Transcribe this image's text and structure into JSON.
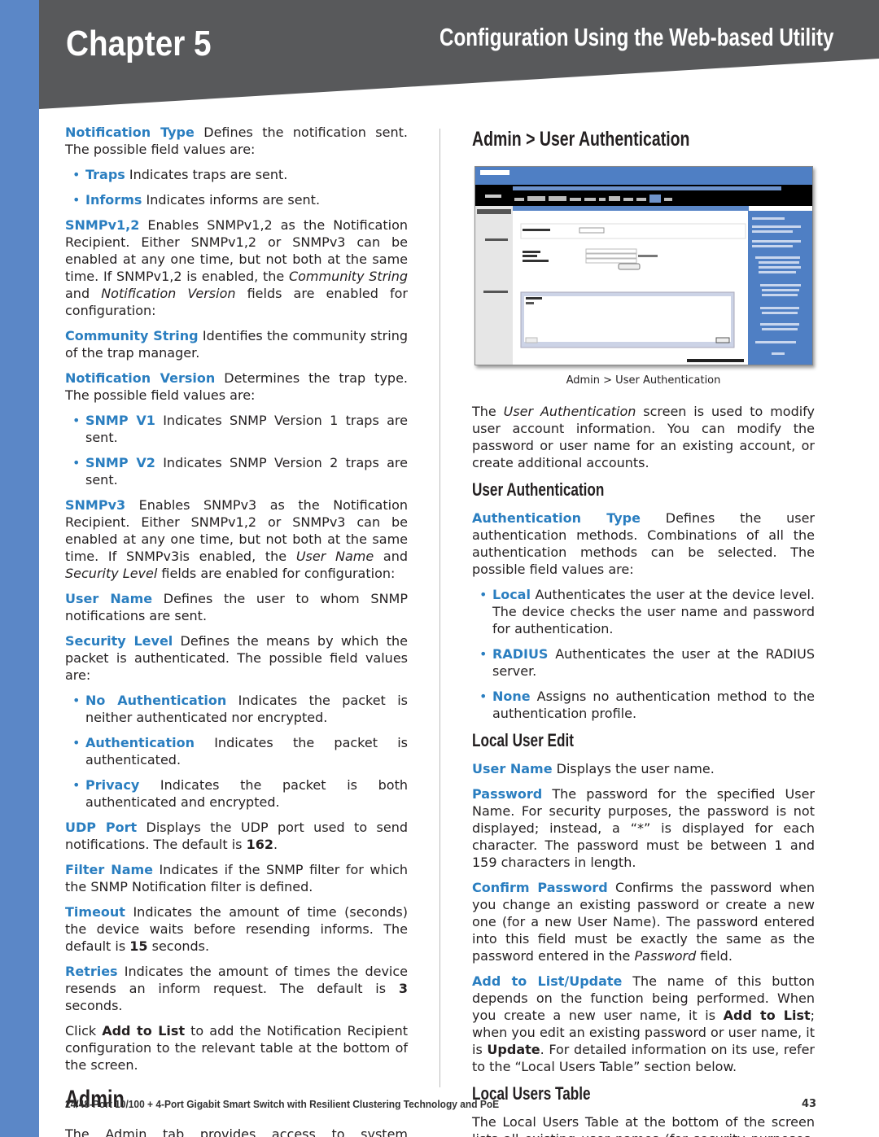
{
  "header": {
    "chapter": "Chapter 5",
    "title": "Configuration Using the Web-based Utility"
  },
  "colors": {
    "sidebar": "#5b87c7",
    "header": "#58595b",
    "term": "#2a7ec0"
  },
  "left": [
    {
      "type": "p",
      "runs": [
        [
          "Notification Type",
          "t"
        ],
        [
          " Defines the notification sent. The possible field values are:",
          ""
        ]
      ]
    },
    {
      "type": "li",
      "runs": [
        [
          "Traps",
          "t"
        ],
        [
          "  Indicates traps are sent.",
          ""
        ]
      ]
    },
    {
      "type": "li",
      "runs": [
        [
          "Informs",
          "t"
        ],
        [
          "  Indicates informs are sent.",
          ""
        ]
      ]
    },
    {
      "type": "p",
      "runs": [
        [
          "SNMPv1,2",
          "t"
        ],
        [
          " Enables SNMPv1,2 as the Notification Recipient. Either SNMPv1,2 or SNMPv3 can be enabled at any one time, but not both at the same time. If SNMPv1,2 is enabled, the ",
          ""
        ],
        [
          "Community String",
          "i"
        ],
        [
          " and ",
          ""
        ],
        [
          "Notification Version",
          "i"
        ],
        [
          " fields are enabled for configuration:",
          ""
        ]
      ]
    },
    {
      "type": "p",
      "runs": [
        [
          "Community String",
          "t"
        ],
        [
          "  Identifies the community string of the trap manager.",
          ""
        ]
      ]
    },
    {
      "type": "p",
      "runs": [
        [
          "Notification Version",
          "t"
        ],
        [
          "  Determines the trap type. The possible field values are:",
          ""
        ]
      ]
    },
    {
      "type": "li",
      "runs": [
        [
          "SNMP V1",
          "t"
        ],
        [
          "  Indicates SNMP Version 1 traps are sent.",
          ""
        ]
      ]
    },
    {
      "type": "li",
      "runs": [
        [
          "SNMP V2",
          "t"
        ],
        [
          "  Indicates SNMP Version 2 traps are sent.",
          ""
        ]
      ]
    },
    {
      "type": "p",
      "runs": [
        [
          "SNMPv3",
          "t"
        ],
        [
          "  Enables SNMPv3 as the Notification Recipient. Either SNMPv1,2 or SNMPv3 can be enabled at any one time, but not both at the same time. If SNMPv3is enabled, the ",
          ""
        ],
        [
          "User Name",
          "i"
        ],
        [
          " and ",
          ""
        ],
        [
          "Security Level",
          "i"
        ],
        [
          " fields are enabled for configuration:",
          ""
        ]
      ]
    },
    {
      "type": "p",
      "runs": [
        [
          "User Name",
          "t"
        ],
        [
          "  Defines the user to whom SNMP notifications are sent.",
          ""
        ]
      ]
    },
    {
      "type": "p",
      "runs": [
        [
          "Security Level",
          "t"
        ],
        [
          "  Defines the means by which the packet is authenticated. The possible field values are:",
          ""
        ]
      ]
    },
    {
      "type": "li",
      "runs": [
        [
          "No Authentication",
          "t"
        ],
        [
          "  Indicates the packet is neither authenticated nor encrypted.",
          ""
        ]
      ]
    },
    {
      "type": "li",
      "runs": [
        [
          "Authentication",
          "t"
        ],
        [
          "  Indicates the packet is authenticated.",
          ""
        ]
      ]
    },
    {
      "type": "li",
      "runs": [
        [
          "Privacy",
          "t"
        ],
        [
          "  Indicates the packet is both authenticated and encrypted.",
          ""
        ]
      ]
    },
    {
      "type": "p",
      "runs": [
        [
          "UDP Port",
          "t"
        ],
        [
          "  Displays the UDP port used to send notifications. The default is ",
          ""
        ],
        [
          "162",
          "b"
        ],
        [
          ".",
          ""
        ]
      ]
    },
    {
      "type": "p",
      "runs": [
        [
          "Filter Name",
          "t"
        ],
        [
          "  Indicates if the SNMP filter for which the SNMP Notification filter is defined.",
          ""
        ]
      ]
    },
    {
      "type": "p",
      "runs": [
        [
          "Timeout",
          "t"
        ],
        [
          "  Indicates the amount of time (seconds) the device waits before resending informs. The default is ",
          ""
        ],
        [
          "15",
          "b"
        ],
        [
          " seconds.",
          ""
        ]
      ]
    },
    {
      "type": "p",
      "runs": [
        [
          "Retries",
          "t"
        ],
        [
          "  Indicates the amount of times the device resends an inform request. The default is ",
          ""
        ],
        [
          "3",
          "b"
        ],
        [
          " seconds.",
          ""
        ]
      ]
    },
    {
      "type": "p",
      "runs": [
        [
          "Click ",
          ""
        ],
        [
          "Add to List",
          "b"
        ],
        [
          " to add the Notification Recipient configuration to the relevant table at the bottom of the screen.",
          ""
        ]
      ]
    },
    {
      "type": "h2",
      "runs": [
        [
          "Admin",
          ""
        ]
      ]
    },
    {
      "type": "p",
      "runs": [
        [
          "The Admin tab provides access to system administration settings and tools. It includes the following screens:",
          ""
        ]
      ]
    }
  ],
  "right": [
    {
      "type": "h1r",
      "runs": [
        [
          "Admin > User Authentication",
          ""
        ]
      ]
    },
    {
      "type": "figure",
      "caption": "Admin > User Authentication"
    },
    {
      "type": "p",
      "runs": [
        [
          "The ",
          ""
        ],
        [
          "User Authentication",
          "i"
        ],
        [
          " screen is used to modify user account information. You can modify the password or user name for an existing account, or create additional accounts.",
          ""
        ]
      ]
    },
    {
      "type": "h3",
      "runs": [
        [
          "User Authentication",
          ""
        ]
      ]
    },
    {
      "type": "p",
      "runs": [
        [
          "Authentication Type",
          "t"
        ],
        [
          "  Defines the user authentication methods. Combinations of all the authentication methods can be selected. The possible field values are:",
          ""
        ]
      ]
    },
    {
      "type": "li",
      "runs": [
        [
          "Local",
          "t"
        ],
        [
          "  Authenticates the user at the device level. The device checks the user name and password for authentication.",
          ""
        ]
      ]
    },
    {
      "type": "li",
      "runs": [
        [
          "RADIUS",
          "t"
        ],
        [
          "  Authenticates the user at the RADIUS server.",
          ""
        ]
      ]
    },
    {
      "type": "li",
      "runs": [
        [
          "None",
          "t"
        ],
        [
          "  Assigns no authentication method to the authentication profile.",
          ""
        ]
      ]
    },
    {
      "type": "h3",
      "runs": [
        [
          "Local User Edit",
          ""
        ]
      ]
    },
    {
      "type": "p",
      "runs": [
        [
          "User Name",
          "t"
        ],
        [
          "  Displays the user name.",
          ""
        ]
      ]
    },
    {
      "type": "p",
      "runs": [
        [
          "Password",
          "t"
        ],
        [
          "  The password for the specified User Name. For security purposes, the password is not displayed; instead, a “*” is displayed for each character. The password must be between 1 and 159 characters in length.",
          ""
        ]
      ]
    },
    {
      "type": "p",
      "runs": [
        [
          "Confirm Password",
          "t"
        ],
        [
          "  Confirms the password when you change an existing password or create a new one (for a new User Name). The password entered into this field must be exactly the same as the password entered in the ",
          ""
        ],
        [
          "Password",
          "i"
        ],
        [
          " field.",
          ""
        ]
      ]
    },
    {
      "type": "p",
      "runs": [
        [
          "Add to List/Update",
          "t"
        ],
        [
          "  The name of this button depends on the function being performed. When you create a new user name, it is ",
          ""
        ],
        [
          "Add to List",
          "b"
        ],
        [
          "; when you edit an existing password or user name, it is ",
          ""
        ],
        [
          "Update",
          "b"
        ],
        [
          ". For detailed information on its use, refer to the “Local Users Table” section below.",
          ""
        ]
      ]
    },
    {
      "type": "h3",
      "runs": [
        [
          "Local Users Table",
          ""
        ]
      ]
    },
    {
      "type": "p",
      "runs": [
        [
          "The Local Users Table at the bottom of the screen lists all existing user names (for security purposes, passwords are",
          ""
        ]
      ]
    }
  ],
  "footer": {
    "product": "24/48-Port 10/100 + 4-Port Gigabit Smart Switch with Resilient Clustering Technology and PoE",
    "page": "43"
  }
}
